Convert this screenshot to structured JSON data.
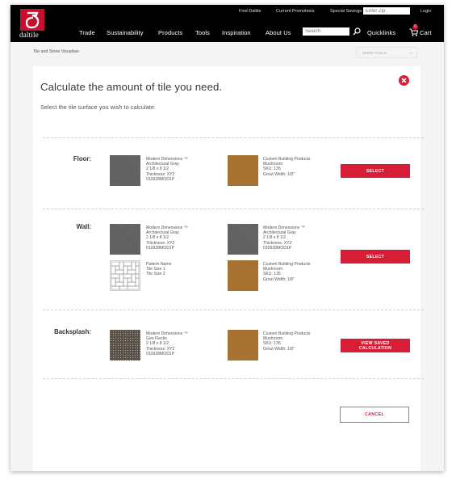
{
  "brand": {
    "wordmark": "daltile",
    "accent": "#c8102e"
  },
  "utility_nav": {
    "find_daltile": "Find Daltile",
    "current_promotions": "Current Promotions",
    "special_savings": "Special Savings",
    "zip_placeholder": "Enter Zip",
    "login": "Login"
  },
  "main_nav": {
    "items": [
      "Trade",
      "Sustainability",
      "Products",
      "Tools",
      "Inspiration",
      "About Us"
    ],
    "search_placeholder": "Search",
    "quicklinks": "Quicklinks",
    "cart_label": "Cart",
    "cart_count": "0"
  },
  "subbar": {
    "breadcrumb": "Tile and Stone Visualiser",
    "more_tools": "MORE TOOLS"
  },
  "dialog": {
    "title": "Calculate the amount of tile you need.",
    "subtitle": "Select the tile surface you wish to calculate:",
    "surfaces": [
      {
        "label": "Floor:",
        "button": "SELECT",
        "items": [
          {
            "lines": [
              "Modern Dimensions ™",
              "Architectural Gray",
              "2 1/8 x 8 1/2",
              "Thickness: XYZ",
              "010928MOD1P"
            ]
          },
          {
            "lines": [
              "Custom Building Products",
              "Mushroom",
              "SKU: 135",
              "Grout Width: 1/8\""
            ]
          }
        ]
      },
      {
        "label": "Wall:",
        "button": "SELECT",
        "items": [
          {
            "lines": [
              "Modern Dimensions ™",
              "Architectural Gray",
              "2 1/8 x 8 1/2",
              "Thickness: XYZ",
              "010928MOD1P"
            ]
          },
          {
            "lines": [
              "Modern Dimensions ™",
              "Architectural Gray",
              "2 1/8 x 8 1/2",
              "Thickness: XYZ",
              "010928MOD1P"
            ]
          },
          {
            "lines": [
              "Pattern Name",
              "Tile Size 1",
              "Tile Size 2"
            ]
          },
          {
            "lines": [
              "Custom Building Products",
              "Mushroom",
              "SKU: 135",
              "Grout Width: 1/8\""
            ]
          }
        ]
      },
      {
        "label": "Backsplash:",
        "button_line1": "VIEW SAVED",
        "button_line2": "CALCULATION",
        "items": [
          {
            "lines": [
              "Modern Dimensions ™",
              "Geo Flecks",
              "2 1/8 x 8 1/2",
              "Thickness: XYZ",
              "010928MOD1P"
            ]
          },
          {
            "lines": [
              "Custom Building Products",
              "Mushroom",
              "SKU: 135",
              "Grout Width: 1/8\""
            ]
          }
        ]
      }
    ],
    "cancel": "CANCEL"
  }
}
